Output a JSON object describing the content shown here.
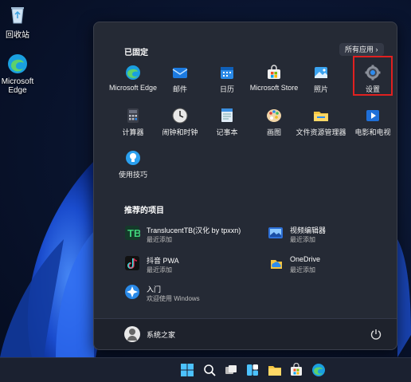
{
  "desktop": {
    "icons": [
      {
        "label": "回收站",
        "icon": "recycle-bin-icon"
      },
      {
        "label": "Microsoft Edge",
        "icon": "edge-icon"
      }
    ]
  },
  "start_menu": {
    "pinned_title": "已固定",
    "all_apps_label": "所有应用",
    "pinned": [
      {
        "label": "Microsoft Edge",
        "icon": "edge-icon"
      },
      {
        "label": "邮件",
        "icon": "mail-icon"
      },
      {
        "label": "日历",
        "icon": "calendar-icon"
      },
      {
        "label": "Microsoft Store",
        "icon": "store-icon"
      },
      {
        "label": "照片",
        "icon": "photos-icon"
      },
      {
        "label": "设置",
        "icon": "settings-icon"
      },
      {
        "label": "计算器",
        "icon": "calculator-icon"
      },
      {
        "label": "闹钟和时钟",
        "icon": "clock-icon"
      },
      {
        "label": "记事本",
        "icon": "notepad-icon"
      },
      {
        "label": "画图",
        "icon": "paint-icon"
      },
      {
        "label": "文件资源管理器",
        "icon": "folder-icon"
      },
      {
        "label": "电影和电视",
        "icon": "movies-icon"
      },
      {
        "label": "使用技巧",
        "icon": "tips-icon"
      }
    ],
    "recommended_title": "推荐的项目",
    "recommended": [
      {
        "name": "TranslucentTB(汉化 by tpxxn)",
        "sub": "最近添加",
        "icon": "translucenttb-icon"
      },
      {
        "name": "视频编辑器",
        "sub": "最近添加",
        "icon": "video-editor-icon"
      },
      {
        "name": "抖音 PWA",
        "sub": "最近添加",
        "icon": "douyin-icon"
      },
      {
        "name": "OneDrive",
        "sub": "最近添加",
        "icon": "onedrive-icon"
      },
      {
        "name": "入门",
        "sub": "欢迎使用 Windows",
        "icon": "get-started-icon"
      }
    ],
    "user_name": "系统之家",
    "highlight_color": "#e02020"
  },
  "taskbar": {
    "icons": [
      "start-icon",
      "search-icon",
      "task-view-icon",
      "widgets-icon",
      "file-explorer-icon",
      "store-icon",
      "edge-icon"
    ]
  }
}
